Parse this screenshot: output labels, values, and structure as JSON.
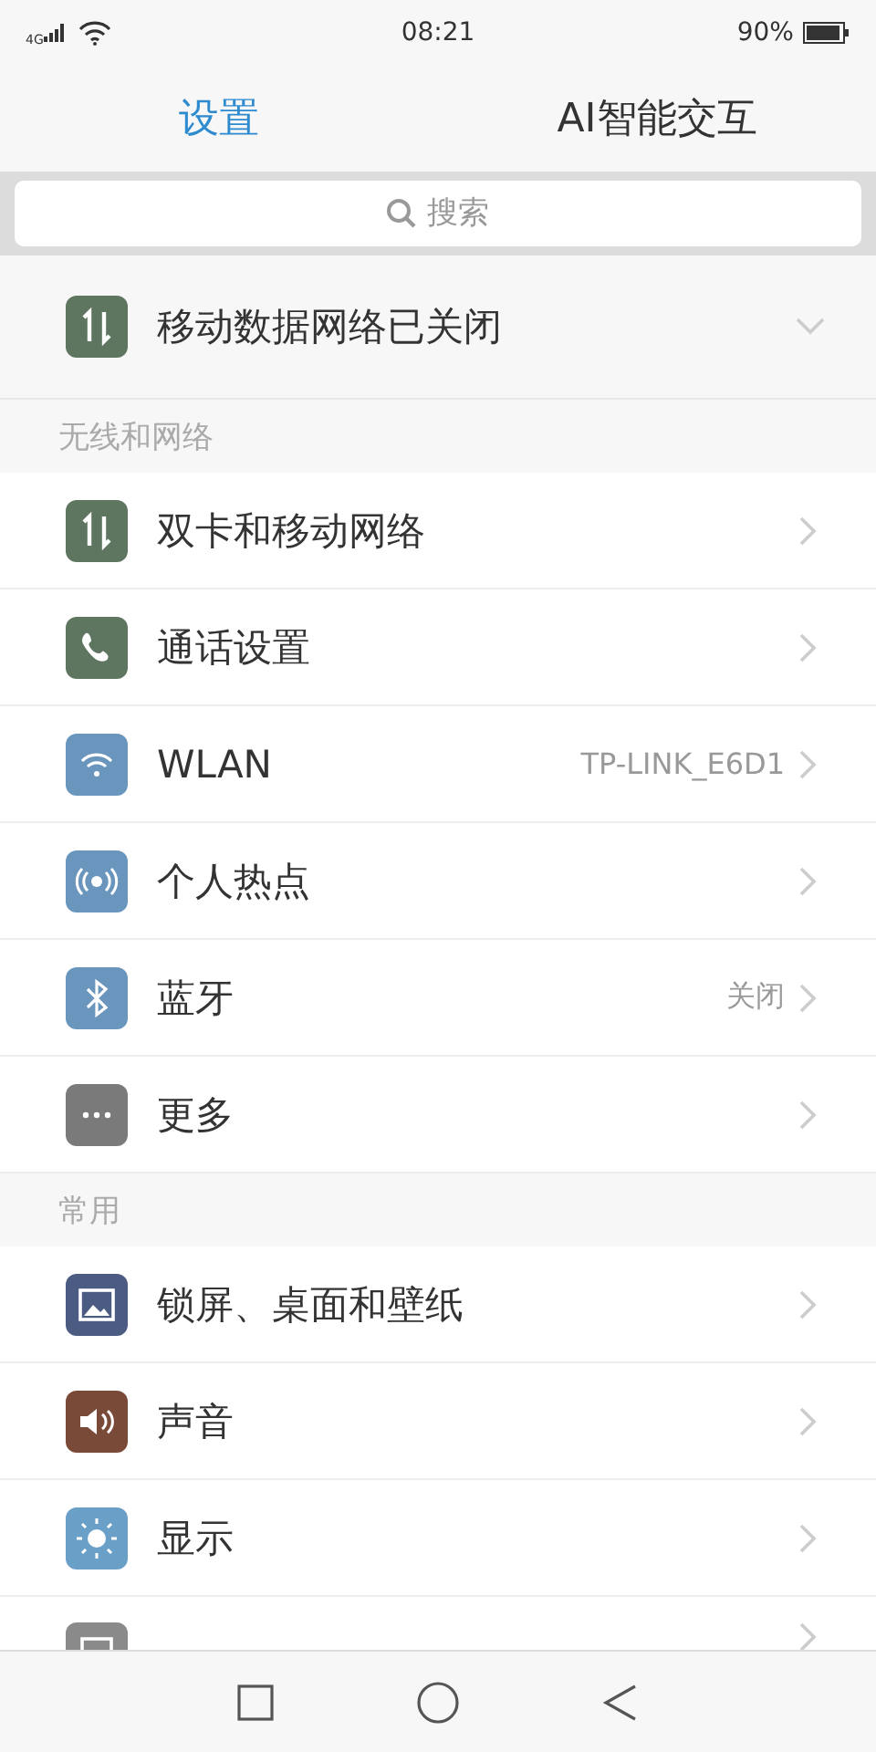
{
  "status_bar": {
    "network": "4G",
    "time": "08:21",
    "battery": "90%"
  },
  "tabs": [
    {
      "label": "设置",
      "selected": true
    },
    {
      "label": "AI智能交互",
      "selected": false
    }
  ],
  "search": {
    "placeholder": "搜索"
  },
  "banner": {
    "label": "移动数据网络已关闭"
  },
  "sections": [
    {
      "title": "无线和网络",
      "items": [
        {
          "label": "双卡和移动网络"
        },
        {
          "label": "通话设置"
        },
        {
          "label": "WLAN",
          "value": "TP-LINK_E6D1"
        },
        {
          "label": "个人热点"
        },
        {
          "label": "蓝牙",
          "value": "关闭"
        },
        {
          "label": "更多"
        }
      ]
    },
    {
      "title": "常用",
      "items": [
        {
          "label": "锁屏、桌面和壁纸"
        },
        {
          "label": "声音"
        },
        {
          "label": "显示"
        },
        {
          "kind": "partial"
        }
      ]
    }
  ]
}
